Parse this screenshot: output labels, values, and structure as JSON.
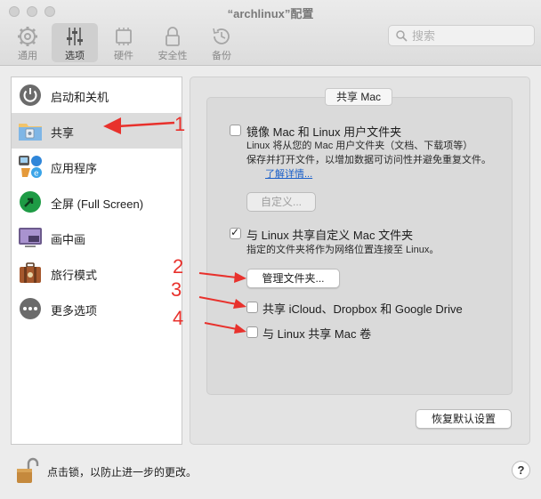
{
  "window": {
    "title": "“archlinux”配置"
  },
  "toolbar": {
    "tabs": [
      {
        "label": "通用",
        "icon": "gear-icon"
      },
      {
        "label": "选项",
        "icon": "sliders-icon"
      },
      {
        "label": "硬件",
        "icon": "chip-icon"
      },
      {
        "label": "安全性",
        "icon": "lock-icon"
      },
      {
        "label": "备份",
        "icon": "clock-backup-icon"
      }
    ],
    "active_tab": "选项",
    "search_placeholder": "搜索"
  },
  "sidebar": {
    "items": [
      {
        "label": "启动和关机",
        "icon": "power-icon"
      },
      {
        "label": "共享",
        "icon": "shared-folder-icon",
        "selected": true
      },
      {
        "label": "应用程序",
        "icon": "applications-icon"
      },
      {
        "label": "全屏 (Full Screen)",
        "icon": "fullscreen-icon"
      },
      {
        "label": "画中画",
        "icon": "picture-in-picture-icon"
      },
      {
        "label": "旅行模式",
        "icon": "suitcase-icon"
      },
      {
        "label": "更多选项",
        "icon": "more-options-icon"
      }
    ]
  },
  "sharing": {
    "group_title": "共享 Mac",
    "mirror": {
      "label": "镜像 Mac 和 Linux 用户文件夹",
      "checked": false,
      "desc_line1": "Linux 将从您的 Mac 用户文件夹（文档、下载项等）",
      "desc_line2": "保存并打开文件，以增加数据可访问性并避免重复文件。",
      "link": "了解详情...",
      "customize_button": "自定义..."
    },
    "custom_folders": {
      "label": "与 Linux 共享自定义 Mac 文件夹",
      "checked": true,
      "desc": "指定的文件夹将作为网络位置连接至 Linux。",
      "manage_button": "管理文件夹..."
    },
    "cloud": {
      "label": "共享 iCloud、Dropbox 和 Google Drive",
      "checked": false
    },
    "volumes": {
      "label": "与 Linux 共享 Mac 卷",
      "checked": false
    },
    "restore_button": "恢复默认设置"
  },
  "annotations": [
    "1",
    "2",
    "3",
    "4"
  ],
  "accent_color": "#e8312c",
  "footer": {
    "lock_text": "点击锁，以防止进一步的更改。",
    "help_label": "?"
  }
}
